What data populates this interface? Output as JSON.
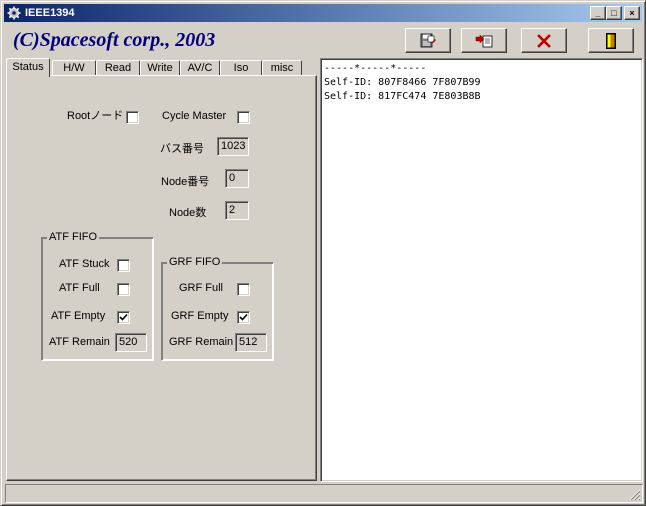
{
  "window": {
    "title": "IEEE1394",
    "minimize_label": "_",
    "maximize_label": "□",
    "close_label": "×"
  },
  "header": {
    "company": "(C)Spacesoft corp., 2003"
  },
  "toolbar": {
    "buttons": [
      {
        "name": "save-log-button",
        "icon": "floppy-save-icon"
      },
      {
        "name": "export-button",
        "icon": "export-arrow-icon"
      },
      {
        "name": "clear-button",
        "icon": "red-x-icon"
      },
      {
        "name": "exit-button",
        "icon": "door-exit-icon"
      }
    ]
  },
  "tabs": [
    {
      "label": "Status",
      "active": true
    },
    {
      "label": "H/W"
    },
    {
      "label": "Read"
    },
    {
      "label": "Write"
    },
    {
      "label": "AV/C"
    },
    {
      "label": "Iso"
    },
    {
      "label": "misc"
    }
  ],
  "status": {
    "root_node_label": "Rootノード",
    "root_node_checked": false,
    "cycle_master_label": "Cycle Master",
    "cycle_master_checked": false,
    "bus_number_label": "バス番号",
    "bus_number_value": "1023",
    "node_number_label": "Node番号",
    "node_number_value": "0",
    "node_count_label": "Node数",
    "node_count_value": "2"
  },
  "atf_fifo": {
    "title": "ATF FIFO",
    "stuck_label": "ATF Stuck",
    "stuck_checked": false,
    "full_label": "ATF Full",
    "full_checked": false,
    "empty_label": "ATF Empty",
    "empty_checked": true,
    "remain_label": "ATF Remain",
    "remain_value": "520"
  },
  "grf_fifo": {
    "title": "GRF FIFO",
    "full_label": "GRF Full",
    "full_checked": false,
    "empty_label": "GRF Empty",
    "empty_checked": true,
    "remain_label": "GRF Remain",
    "remain_value": "512"
  },
  "log": {
    "lines": [
      "-----*-----*-----",
      "Self-ID: 807F8466 7F807B99",
      "Self-ID: 817FC474 7E803B8B"
    ]
  },
  "statusbar": {
    "text": ""
  },
  "colors": {
    "titlebar_start": "#0a246a",
    "titlebar_end": "#a6caf0",
    "company_text": "#00007b",
    "face": "#d4d0c8"
  }
}
